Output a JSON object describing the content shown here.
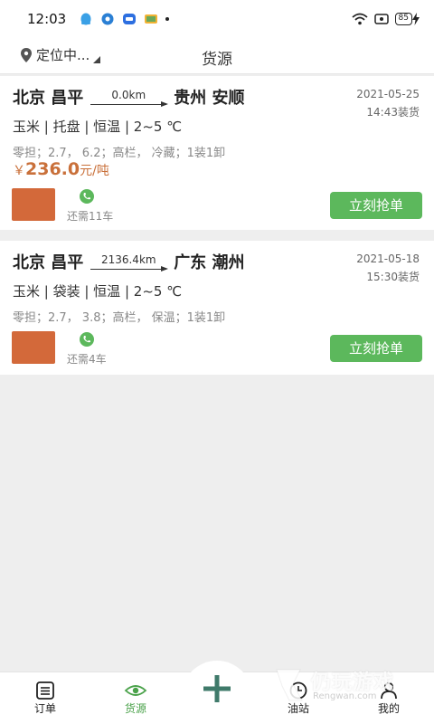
{
  "status_bar": {
    "time": "12:03",
    "battery": "85"
  },
  "header": {
    "location": "定位中...",
    "title": "货源"
  },
  "orders": [
    {
      "origin": "北京 昌平",
      "distance": "0.0km",
      "destination": "贵州 安顺",
      "date": "2021-05-25",
      "time": "14:43装货",
      "specs": "玉米 | 托盘 | 恒温 | 2~5 ℃",
      "details": "零担；2.7，  6.2；高栏，  冷藏；1装1卸",
      "price_symbol": "￥",
      "price": "236.0",
      "price_unit": "元/吨",
      "remaining": "还需11车",
      "button": "立刻抢单"
    },
    {
      "origin": "北京 昌平",
      "distance": "2136.4km",
      "destination": "广东 潮州",
      "date": "2021-05-18",
      "time": "15:30装货",
      "specs": "玉米 | 袋装 | 恒温 | 2~5 ℃",
      "details": "零担；2.7，  3.8；高栏，  保温；1装1卸",
      "remaining": "还需4车",
      "button": "立刻抢单"
    }
  ],
  "tabs": [
    {
      "label": "订单",
      "icon": "order-list-icon"
    },
    {
      "label": "货源",
      "icon": "eye-icon"
    },
    {
      "label": "",
      "icon": "plus-icon"
    },
    {
      "label": "油站",
      "icon": "clock-icon"
    },
    {
      "label": "我的",
      "icon": "user-icon"
    }
  ],
  "watermark": {
    "text": "仍玩游戏",
    "sub": "Rengwan.com"
  },
  "colors": {
    "accent_green": "#5cb85c",
    "price_orange": "#c9703a",
    "avatar": "#d3693a",
    "active_tab": "#4aa24a"
  }
}
